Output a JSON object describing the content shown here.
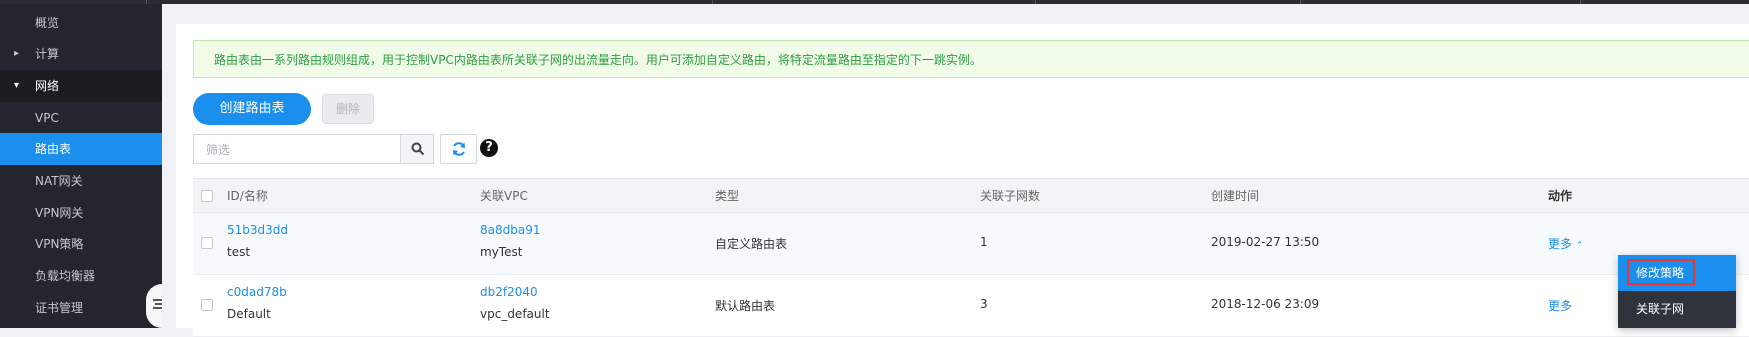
{
  "sidebar": {
    "items": [
      {
        "label": "概览"
      },
      {
        "label": "计算"
      },
      {
        "label": "网络"
      },
      {
        "label": "VPC"
      },
      {
        "label": "路由表"
      },
      {
        "label": "NAT网关"
      },
      {
        "label": "VPN网关"
      },
      {
        "label": "VPN策略"
      },
      {
        "label": "负载均衡器"
      },
      {
        "label": "证书管理"
      }
    ]
  },
  "notice": "路由表由一系列路由规则组成，用于控制VPC内路由表所关联子网的出流量走向。用户可添加自定义路由，将特定流量路由至指定的下一跳实例。",
  "toolbar": {
    "create_label": "创建路由表",
    "delete_label": "删除",
    "filter_placeholder": "筛选",
    "help_label": "?"
  },
  "table": {
    "headers": [
      "ID/名称",
      "关联VPC",
      "类型",
      "关联子网数",
      "创建时间",
      "动作"
    ],
    "rows": [
      {
        "id": "51b3d3dd",
        "name": "test",
        "vpc_id": "8a8dba91",
        "vpc_name": "myTest",
        "type": "自定义路由表",
        "subnets": "1",
        "created": "2019-02-27 13:50",
        "action": "更多"
      },
      {
        "id": "c0dad78b",
        "name": "Default",
        "vpc_id": "db2f2040",
        "vpc_name": "vpc_default",
        "type": "默认路由表",
        "subnets": "3",
        "created": "2018-12-06 23:09",
        "action": "更多"
      }
    ]
  },
  "dropdown": {
    "items": [
      "修改策略",
      "关联子网"
    ]
  },
  "colors": {
    "accent": "#1a8fed",
    "sidebar_bg": "#23262e",
    "highlight": "#e53935",
    "notice_text": "#2e9e44"
  }
}
